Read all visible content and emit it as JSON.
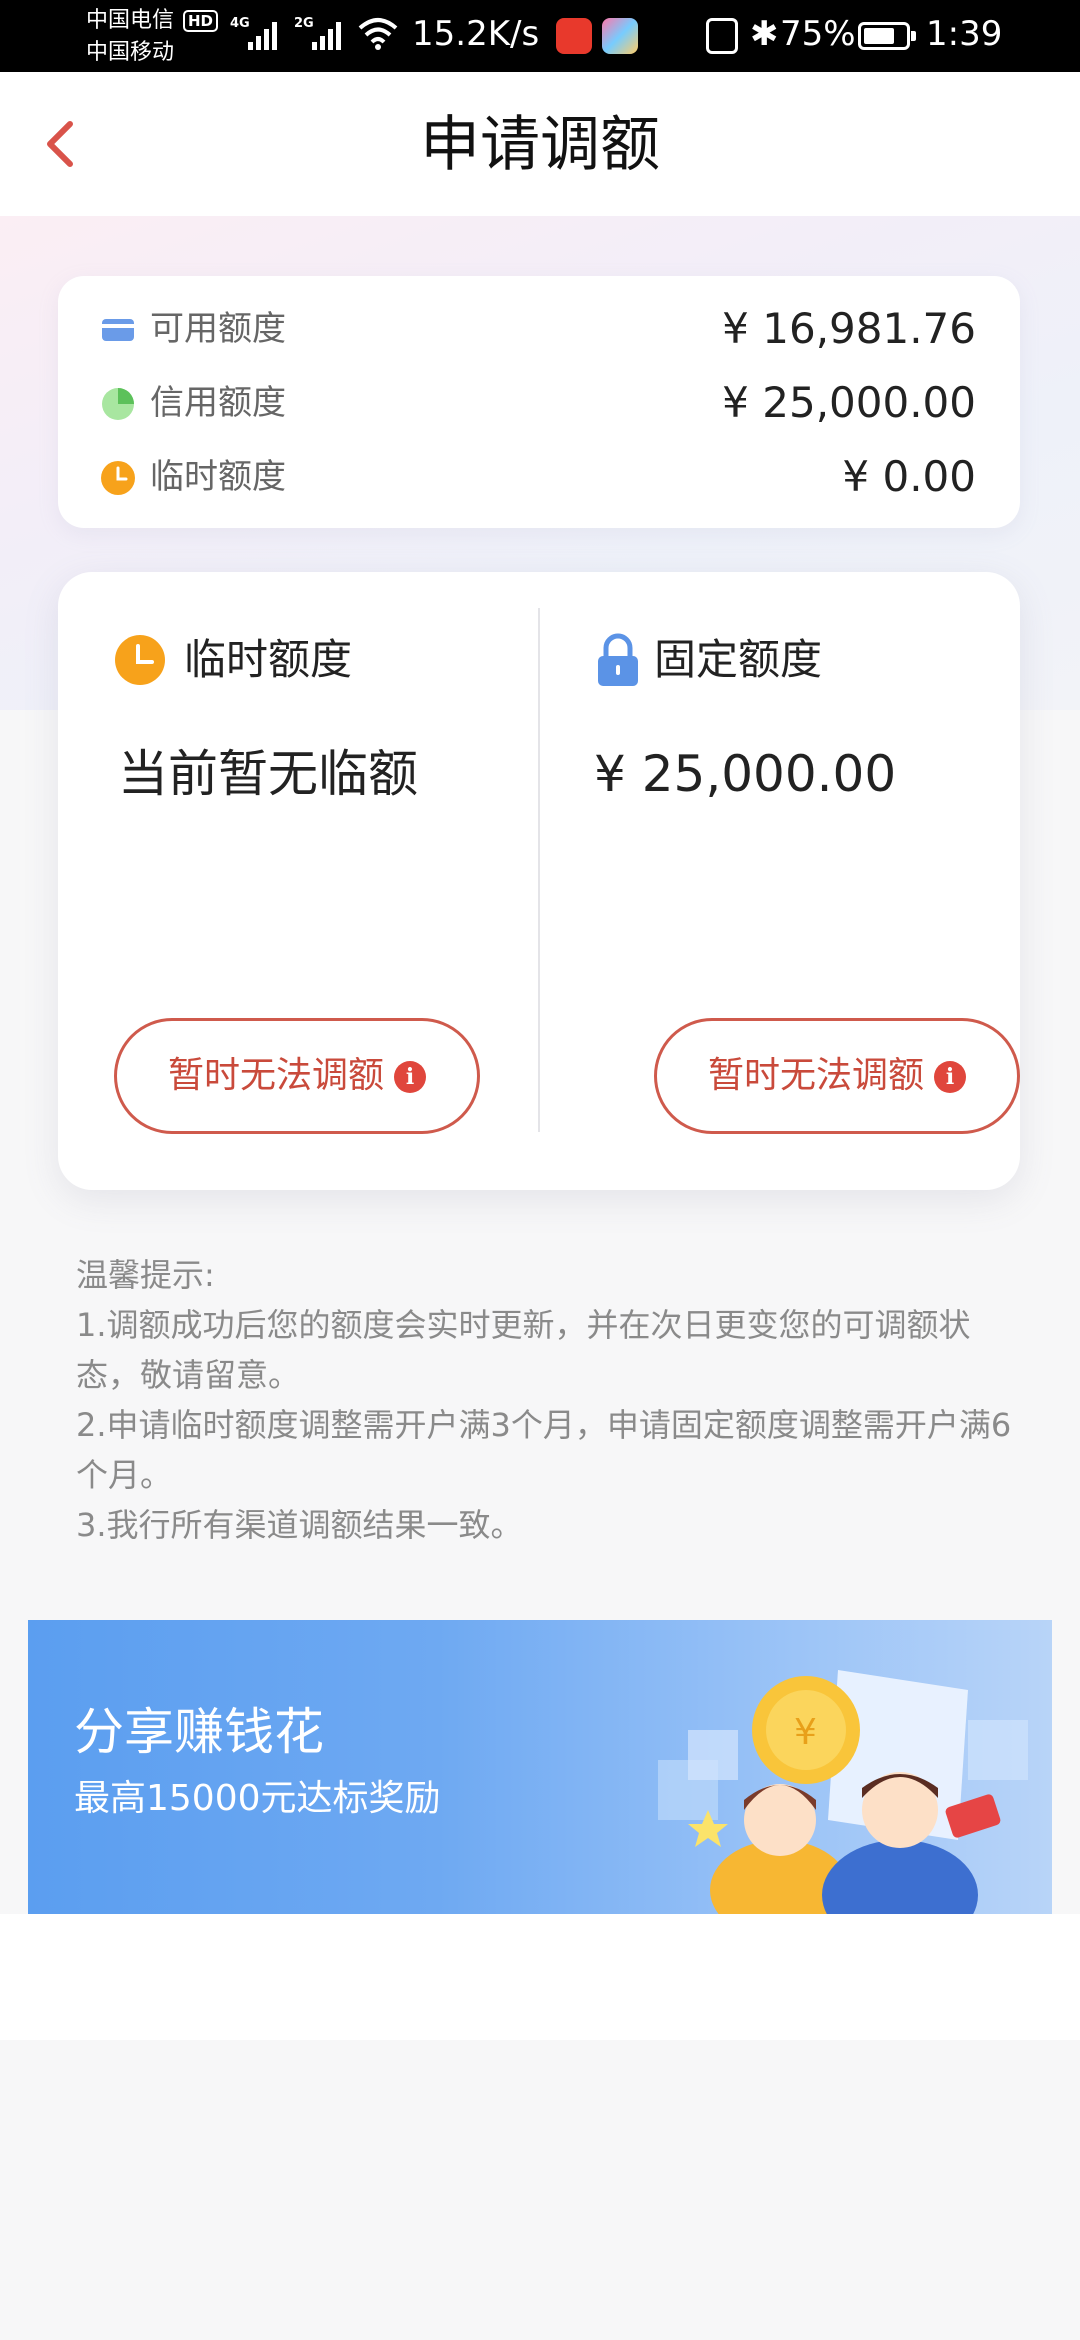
{
  "status_bar": {
    "carrier_1": "中国电信",
    "carrier_2": "中国移动",
    "hd": "HD",
    "net_1": "4G",
    "net_2": "2G",
    "speed": "15.2K/s",
    "battery": "75%",
    "battery_level": 0.75,
    "time": "1:39"
  },
  "nav": {
    "title": "申请调额"
  },
  "summary": [
    {
      "label": "可用额度",
      "value": "¥ 16,981.76",
      "icon": "card-icon",
      "color": "#6a9be8"
    },
    {
      "label": "信用额度",
      "value": "¥ 25,000.00",
      "icon": "pie-icon",
      "color": "#7ed67a"
    },
    {
      "label": "临时额度",
      "value": "¥ 0.00",
      "icon": "clock-icon",
      "color": "#f7a21b"
    }
  ],
  "quota": {
    "temporary": {
      "title": "临时额度",
      "value": "当前暂无临额",
      "button": "暂时无法调额"
    },
    "fixed": {
      "title": "固定额度",
      "value": "¥ 25,000.00",
      "button": "暂时无法调额"
    }
  },
  "tips": {
    "heading": "温馨提示:",
    "items": [
      "1.调额成功后您的额度会实时更新，并在次日更变您的可调额状态，敬请留意。",
      "2.申请临时额度调整需开户满3个月，申请固定额度调整需开户满6个月。",
      "3.我行所有渠道调额结果一致。"
    ]
  },
  "banner": {
    "title": "分享赚钱花",
    "subtitle": "最高15000元达标奖励"
  },
  "colors": {
    "accent_red": "#cf5a4c",
    "back_arrow": "#d9534a",
    "orange": "#f7a21b",
    "lock_blue": "#5b93e6"
  }
}
